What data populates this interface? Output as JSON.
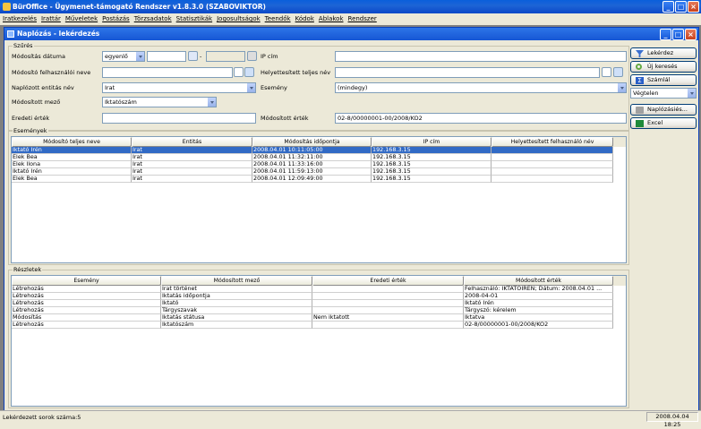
{
  "window": {
    "title": "BürOffice - Ügymenet-támogató Rendszer v1.8.3.0 (SZABOVIKTOR)"
  },
  "menu": [
    "Iratkezelés",
    "Irattár",
    "Műveletek",
    "Postázás",
    "Törzsadatok",
    "Statisztikák",
    "Jogosultságok",
    "Teendők",
    "Kódok",
    "Ablakok",
    "Rendszer"
  ],
  "child": {
    "title": "Naplózás - lekérdezés"
  },
  "filter": {
    "group_label": "Szűrés",
    "date_label": "Módosítás dátuma",
    "date_mode": "egyenlő",
    "date_sep": "-",
    "ip_label": "IP cím",
    "user_label": "Módosító felhasználói neve",
    "subst_user_label": "Helyettesített teljes név",
    "entity_label": "Naplózott entitás név",
    "entity_value": "Irat",
    "event_label": "Esemény",
    "event_value": "(mindegy)",
    "field_label": "Módosított mező",
    "field_value": "Iktatószám",
    "orig_label": "Eredeti érték",
    "mod_label": "Módosított érték",
    "mod_value": "02-8/00000001-00/2008/KO2"
  },
  "actions": {
    "query": "Lekérdez",
    "new_search": "Új keresés",
    "count": "Számlál",
    "range": "Végtelen",
    "log_settings": "Naplózásiés...",
    "excel": "Excel"
  },
  "events": {
    "group_label": "Események",
    "columns": [
      "Módosító teljes neve",
      "Entitás",
      "Módosítás időpontja",
      "IP cím",
      "Helyettesített felhasználó név"
    ],
    "rows": [
      [
        "Iktató Irén",
        "Irat",
        "2008.04.01 10:11:05:00",
        "192.168.3.15",
        ""
      ],
      [
        "Elek Bea",
        "Irat",
        "2008.04.01 11:32:11:00",
        "192.168.3.15",
        ""
      ],
      [
        "Elek Ilona",
        "Irat",
        "2008.04.01 11:33:16:00",
        "192.168.3.15",
        ""
      ],
      [
        "Iktató Irén",
        "Irat",
        "2008.04.01 11:59:13:00",
        "192.168.3.15",
        ""
      ],
      [
        "Elek Bea",
        "Irat",
        "2008.04.01 12:09:49:00",
        "192.168.3.15",
        ""
      ]
    ]
  },
  "details": {
    "group_label": "Részletek",
    "columns": [
      "Esemény",
      "Módosított mező",
      "Eredeti érték",
      "Módosított érték"
    ],
    "rows": [
      [
        "Létrehozás",
        "Irat történet",
        "",
        "Felhasználó: IKTATOIREN; Dátum: 2008.04.01 ..."
      ],
      [
        "Létrehozás",
        "Iktatás időpontja",
        "",
        "2008-04-01"
      ],
      [
        "Létrehozás",
        "Iktató",
        "",
        "Iktató Irén"
      ],
      [
        "Létrehozás",
        "Tárgyszavak",
        "",
        "Tárgyszó: kérelem"
      ],
      [
        "Módosítás",
        "Iktatás státusa",
        "Nem iktatott",
        "Iktatva"
      ],
      [
        "Létrehozás",
        "Iktatószám",
        "",
        "02-8/00000001-00/2008/KO2"
      ]
    ]
  },
  "status": {
    "left": "Lekérdezett sorok száma:5",
    "right": "2008.04.04 18:25"
  },
  "colors": {
    "selection": "#316AC5",
    "titlebar": "#0A5FDB",
    "face": "#ECE9D8"
  }
}
